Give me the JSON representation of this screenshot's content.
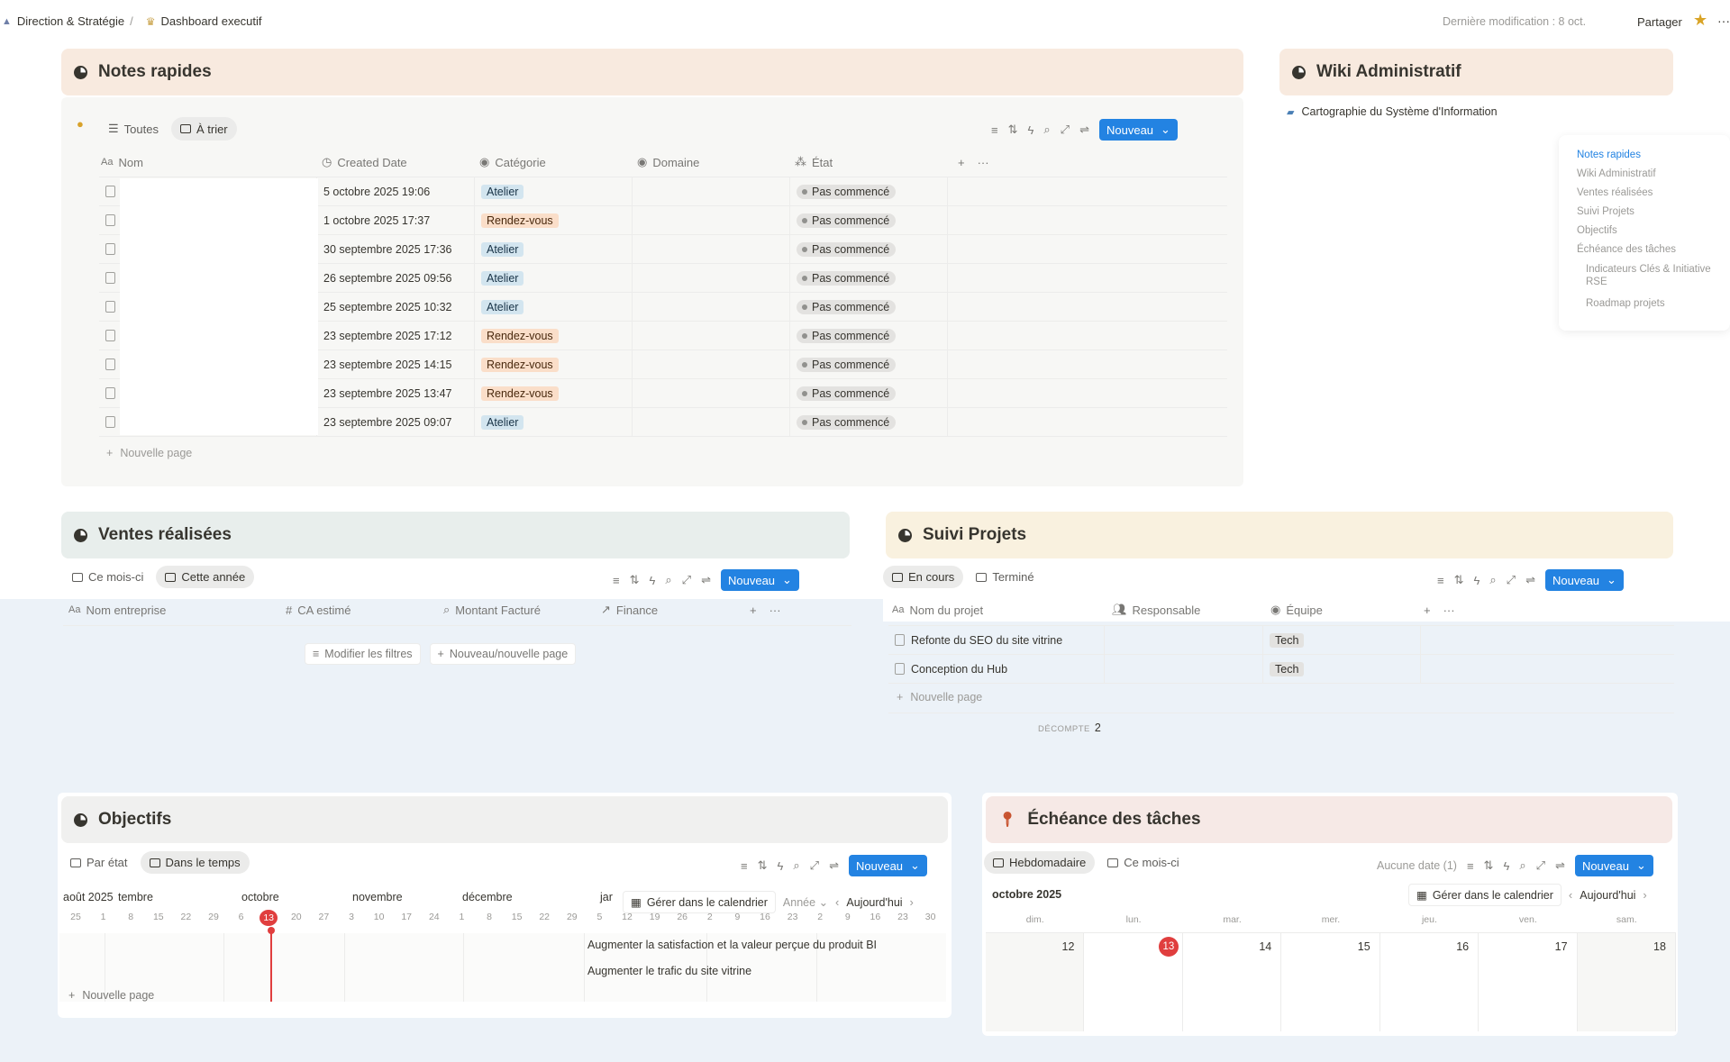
{
  "breadcrumb": {
    "workspace": "Direction & Stratégie",
    "separator": "/",
    "page": "Dashboard executif"
  },
  "topbar": {
    "last_modified": "Dernière modification : 8 oct.",
    "share": "Partager",
    "more": "···"
  },
  "notes": {
    "title": "Notes rapides",
    "tabs": [
      "Toutes",
      "À trier"
    ],
    "new_button": "Nouveau",
    "columns": [
      "Nom",
      "Created Date",
      "Catégorie",
      "Domaine",
      "État"
    ],
    "rows": [
      {
        "date": "5 octobre 2025 19:06",
        "category": "Atelier",
        "status": "Pas commencé"
      },
      {
        "date": "1 octobre 2025 17:37",
        "category": "Rendez-vous",
        "status": "Pas commencé"
      },
      {
        "date": "30 septembre 2025 17:36",
        "category": "Atelier",
        "status": "Pas commencé"
      },
      {
        "date": "26 septembre 2025 09:56",
        "category": "Atelier",
        "status": "Pas commencé"
      },
      {
        "date": "25 septembre 2025 10:32",
        "category": "Atelier",
        "status": "Pas commencé"
      },
      {
        "date": "23 septembre 2025 17:12",
        "category": "Rendez-vous",
        "status": "Pas commencé"
      },
      {
        "date": "23 septembre 2025 14:15",
        "category": "Rendez-vous",
        "status": "Pas commencé"
      },
      {
        "date": "23 septembre 2025 13:47",
        "category": "Rendez-vous",
        "status": "Pas commencé"
      },
      {
        "date": "23 septembre 2025 09:07",
        "category": "Atelier",
        "status": "Pas commencé"
      }
    ],
    "new_page": "Nouvelle page"
  },
  "wiki": {
    "title": "Wiki Administratif",
    "link": "Cartographie du Système d'Information"
  },
  "toc": {
    "items": [
      "Notes rapides",
      "Wiki Administratif",
      "Ventes réalisées",
      "Suivi Projets",
      "Objectifs",
      "Échéance des tâches"
    ],
    "subitems": [
      "Indicateurs Clés & Initiative RSE",
      "Roadmap projets"
    ]
  },
  "ventes": {
    "title": "Ventes réalisées",
    "tabs": [
      "Ce mois-ci",
      "Cette année"
    ],
    "new_button": "Nouveau",
    "columns": [
      "Nom entreprise",
      "CA estimé",
      "Montant Facturé",
      "Finance"
    ],
    "modify_filters": "Modifier les filtres",
    "new_page": "Nouveau/nouvelle page"
  },
  "projets": {
    "title": "Suivi Projets",
    "tabs": [
      "En cours",
      "Terminé"
    ],
    "new_button": "Nouveau",
    "columns": [
      "Nom du projet",
      "Responsable",
      "Équipe"
    ],
    "rows": [
      {
        "name": "Refonte du SEO du site vitrine",
        "team": "Tech"
      },
      {
        "name": "Conception du Hub",
        "team": "Tech"
      }
    ],
    "new_page": "Nouvelle page",
    "count_label": "DÉCOMPTE",
    "count_value": "2"
  },
  "objectifs": {
    "title": "Objectifs",
    "tabs": [
      "Par état",
      "Dans le temps"
    ],
    "new_button": "Nouveau",
    "months": [
      "août 2025",
      "tembre",
      "octobre",
      "novembre",
      "décembre",
      "jar"
    ],
    "days": [
      "25",
      "1",
      "8",
      "15",
      "22",
      "29",
      "6",
      "13",
      "20",
      "27",
      "3",
      "10",
      "17",
      "24",
      "1",
      "8",
      "15",
      "22",
      "29",
      "5",
      "12",
      "19",
      "26",
      "2",
      "9",
      "16",
      "23",
      "2",
      "9",
      "16",
      "23",
      "30"
    ],
    "today": "13",
    "manage_calendar": "Gérer dans le calendrier",
    "zoom": "Année",
    "today_btn": "Aujourd'hui",
    "items": [
      "Augmenter la satisfaction et la valeur perçue du produit BI",
      "Augmenter le trafic du site vitrine"
    ],
    "new_page": "Nouvelle page"
  },
  "echeance": {
    "title": "Échéance des tâches",
    "tabs": [
      "Hebdomadaire",
      "Ce mois-ci"
    ],
    "no_date": "Aucune date (1)",
    "new_button": "Nouveau",
    "month": "octobre 2025",
    "manage_calendar": "Gérer dans le calendrier",
    "today_btn": "Aujourd'hui",
    "weekdays": [
      "dim.",
      "lun.",
      "mar.",
      "mer.",
      "jeu.",
      "ven.",
      "sam."
    ],
    "dates": [
      "12",
      "13",
      "14",
      "15",
      "16",
      "17",
      "18"
    ],
    "today": "13"
  },
  "colors": {
    "notes_header": "#f8eadf",
    "wiki_header": "#f8eadf",
    "ventes_header": "#e8eeec",
    "projets_header": "#f9f1df",
    "objectifs_header": "#f0f0ef",
    "echeance_header": "#f6e9e6",
    "accent": "#2383e2",
    "today": "#e03e3e",
    "background_tint": "#ecf2f8"
  }
}
